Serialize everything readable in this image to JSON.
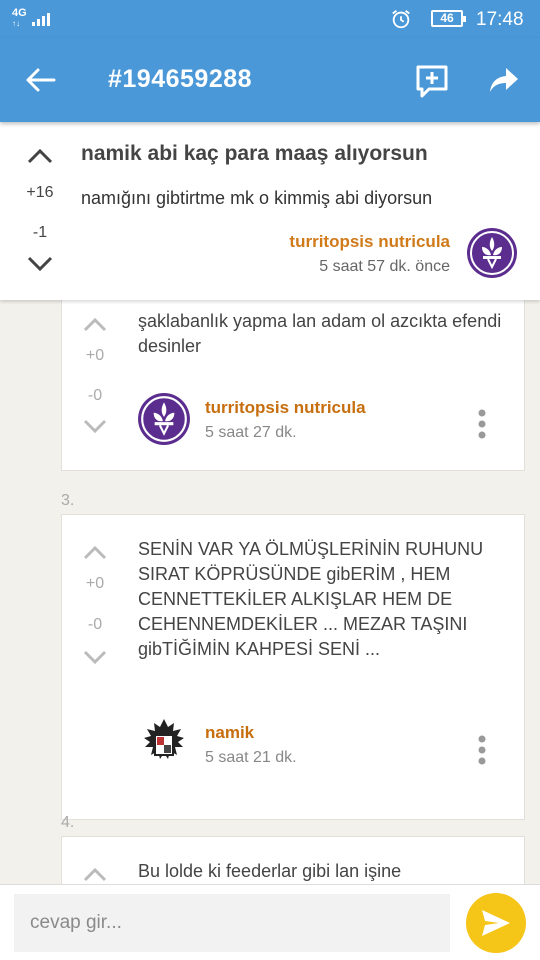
{
  "status_bar": {
    "network": "4G",
    "time": "17:48",
    "battery": "46"
  },
  "toolbar": {
    "title": "#194659288"
  },
  "entry": {
    "title": "namik abi kaç para maaş alıyorsun",
    "text": "namığını gibtirtme mk o kimmiş abi diyorsun",
    "plus_votes": "+16",
    "minus_votes": "-1",
    "author": "turritopsis nutricula",
    "time": "5 saat 57 dk. önce"
  },
  "comments": [
    {
      "text": "şaklabanlık yapma lan adam ol azcıkta efendi desinler",
      "plus_votes": "+0",
      "minus_votes": "-0",
      "author": "turritopsis nutricula",
      "time": "5 saat 27 dk."
    },
    {
      "number": "3.",
      "text": "SENİN VAR YA ÖLMÜŞLERİNİN RUHUNU SIRAT KÖPRÜSÜNDE gibERİM , HEM CENNETTEKİLER ALKIŞLAR HEM DE CEHENNEMDEKİLER ... MEZAR TAŞINI gibTİĞİMİN KAHPESİ SENİ ...",
      "plus_votes": "+0",
      "minus_votes": "-0",
      "author": "namik",
      "time": "5 saat 21 dk."
    },
    {
      "number": "4.",
      "text": "Bu lolde ki feederlar gibi lan işine"
    }
  ],
  "reply": {
    "placeholder": "cevap gir..."
  },
  "colors": {
    "primary": "#4a98d8",
    "author": "#d07a1a",
    "send": "#f5c518",
    "avatar_purple": "#5b2d8e"
  },
  "icons": [
    "back-arrow-icon",
    "add-comment-icon",
    "share-icon",
    "chevron-up-icon",
    "chevron-down-icon",
    "more-vert-icon",
    "send-icon",
    "alarm-icon"
  ]
}
